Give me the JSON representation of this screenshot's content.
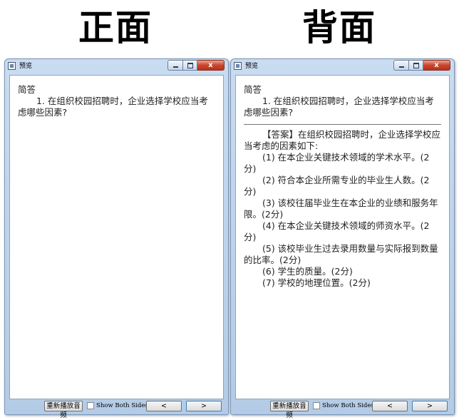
{
  "front_heading": "正面",
  "back_heading": "背面",
  "front_window": {
    "title": "预览",
    "close_glyph": "x",
    "question_type": "简答",
    "question": "1. 在组织校园招聘时，企业选择学校应当考虑哪些因素?",
    "replay_label": "重新播放音频",
    "show_both_label": "Show Both Sides",
    "prev_label": "<",
    "next_label": ">"
  },
  "back_window": {
    "title": "预览",
    "close_glyph": "x",
    "question_type": "简答",
    "question": "1. 在组织校园招聘时，企业选择学校应当考虑哪些因素?",
    "answer_intro": "【答案】在组织校园招聘时，企业选择学校应当考虑的因素如下:",
    "answer_items": [
      "(1) 在本企业关键技术领域的学术水平。(2分)",
      "(2) 符合本企业所需专业的毕业生人数。(2分)",
      "(3) 该校往届毕业生在本企业的业绩和服务年限。(2分)",
      "(4) 在本企业关键技术领域的师资水平。(2分)",
      "(5) 该校毕业生过去录用数量与实际报到数量的比率。(2分)",
      "(6) 学生的质量。(2分)",
      "(7) 学校的地理位置。(2分)"
    ],
    "replay_label": "重新播放音频",
    "show_both_label": "Show Both Sides",
    "prev_label": "<",
    "next_label": ">"
  }
}
